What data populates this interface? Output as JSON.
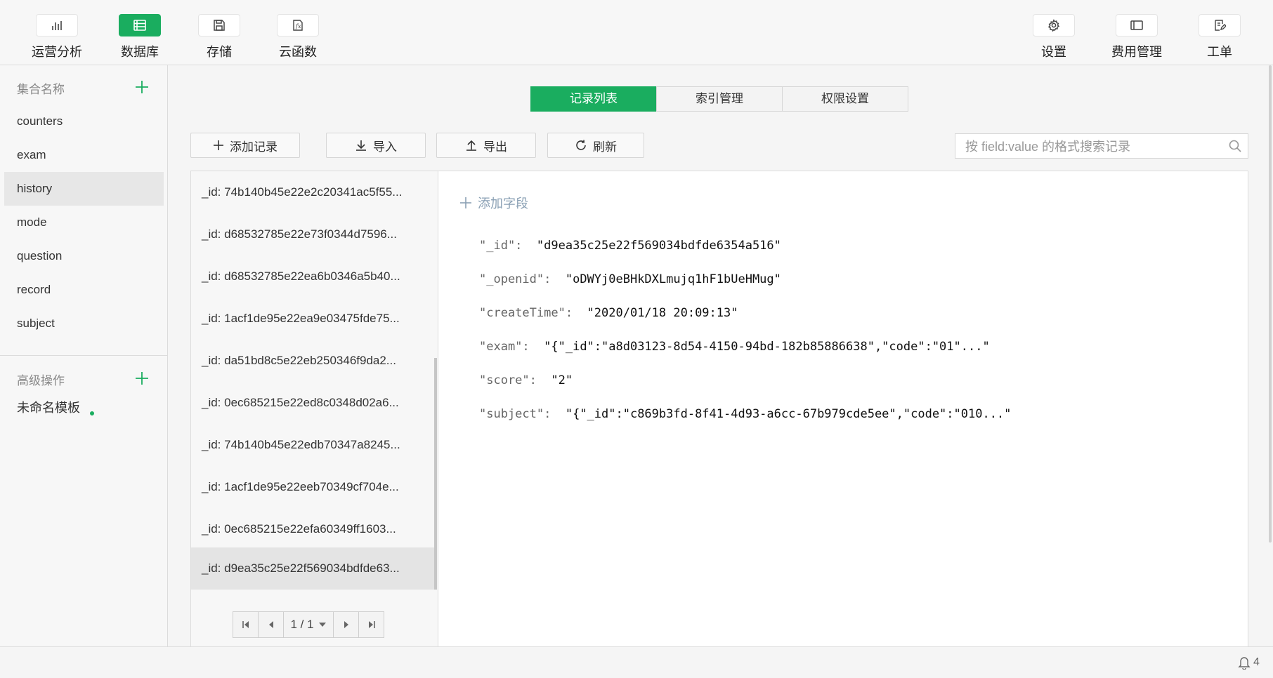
{
  "toolbar": {
    "left": [
      {
        "label": "运营分析",
        "icon": "bar-chart-icon"
      },
      {
        "label": "数据库",
        "icon": "database-icon",
        "active": true
      },
      {
        "label": "存储",
        "icon": "save-icon"
      },
      {
        "label": "云函数",
        "icon": "function-icon"
      }
    ],
    "right": [
      {
        "label": "设置",
        "icon": "gear-icon"
      },
      {
        "label": "费用管理",
        "icon": "billing-icon"
      },
      {
        "label": "工单",
        "icon": "ticket-icon"
      }
    ]
  },
  "sidebar": {
    "collections_title": "集合名称",
    "collections": [
      "counters",
      "exam",
      "history",
      "mode",
      "question",
      "record",
      "subject"
    ],
    "selected_collection": "history",
    "advanced_title": "高级操作",
    "template": "未命名模板"
  },
  "tabs": [
    "记录列表",
    "索引管理",
    "权限设置"
  ],
  "active_tab": "记录列表",
  "actions": {
    "add": "添加记录",
    "import": "导入",
    "export": "导出",
    "refresh": "刷新"
  },
  "search": {
    "placeholder": "按 field:value 的格式搜索记录",
    "value": ""
  },
  "records": [
    "_id: 74b140b45e22e2c20341ac5f55...",
    "_id: d68532785e22e73f0344d7596...",
    "_id: d68532785e22ea6b0346a5b40...",
    "_id: 1acf1de95e22ea9e03475fde75...",
    "_id: da51bd8c5e22eb250346f9da2...",
    "_id: 0ec685215e22ed8c0348d02a6...",
    "_id: 74b140b45e22edb70347a8245...",
    "_id: 1acf1de95e22eeb70349cf704e...",
    "_id: 0ec685215e22efa60349ff1603...",
    "_id: d9ea35c25e22f569034bdfde63..."
  ],
  "pager": {
    "page": "1 / 1"
  },
  "detail": {
    "add_field": "添加字段",
    "fields": [
      {
        "key": "\"_id\":",
        "value": "\"d9ea35c25e22f569034bdfde6354a516\""
      },
      {
        "key": "\"_openid\":",
        "value": "\"oDWYj0eBHkDXLmujq1hF1bUeHMug\""
      },
      {
        "key": "\"createTime\":",
        "value": "\"2020/01/18 20:09:13\""
      },
      {
        "key": "\"exam\":",
        "value": "\"{\"_id\":\"a8d03123-8d54-4150-94bd-182b85886638\",\"code\":\"01\"...\""
      },
      {
        "key": "\"score\":",
        "value": "\"2\""
      },
      {
        "key": "\"subject\":",
        "value": "\"{\"_id\":\"c869b3fd-8f41-4d93-a6cc-67b979cde5ee\",\"code\":\"010...\""
      }
    ]
  },
  "status": {
    "notifications": "4"
  },
  "colors": {
    "accent": "#1aad5f",
    "add_field": "#8aa0b4"
  }
}
